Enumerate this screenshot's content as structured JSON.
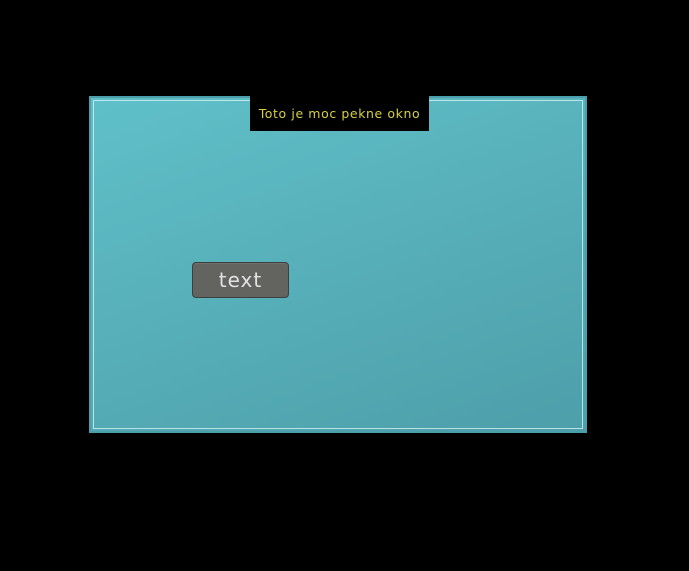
{
  "window": {
    "title": "Toto je moc pekne okno"
  },
  "button": {
    "label": "text"
  },
  "colors": {
    "background": "#000000",
    "window_fill": "#5ab6c0",
    "title_text": "#d8d040",
    "button_fill": "#636360",
    "button_text": "#e2e2e2"
  }
}
